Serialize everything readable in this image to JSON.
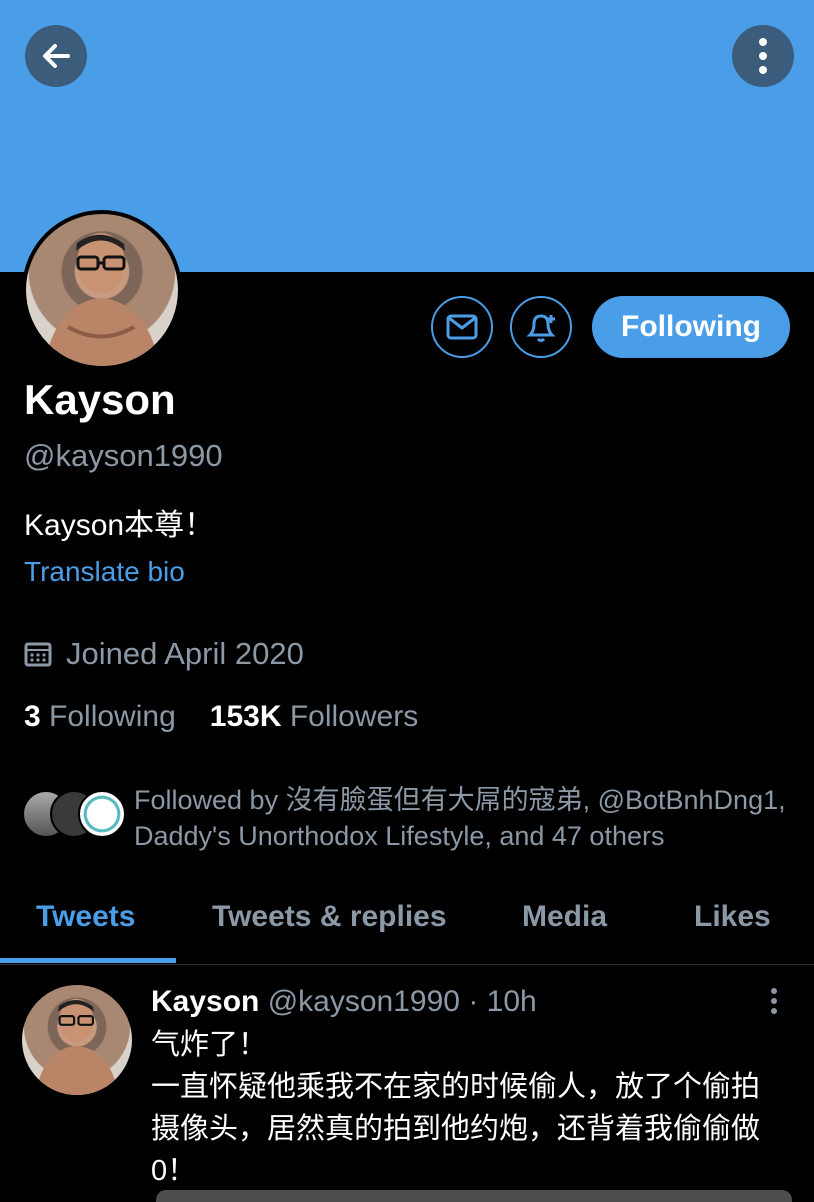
{
  "header": {
    "back_icon": "back-arrow-icon",
    "more_icon": "more-vertical-icon",
    "banner_color": "#4a9ee8"
  },
  "actions": {
    "message_icon": "envelope-icon",
    "notify_icon": "bell-plus-icon",
    "follow_label": "Following"
  },
  "profile": {
    "name": "Kayson",
    "handle": "@kayson1990",
    "bio": "Kayson本尊！",
    "translate_label": "Translate bio",
    "joined": "Joined April 2020",
    "following_count": "3",
    "following_label": "Following",
    "followers_count": "153K",
    "followers_label": "Followers",
    "followed_by_line1": "Followed by 沒有臉蛋但有大屌的寇弟, @BotBnhDng1,",
    "followed_by_line2": "Daddy's Unorthodox Lifestyle, and 47 others"
  },
  "tabs": [
    {
      "label": "Tweets",
      "active": true
    },
    {
      "label": "Tweets & replies",
      "active": false
    },
    {
      "label": "Media",
      "active": false
    },
    {
      "label": "Likes",
      "active": false
    }
  ],
  "tweet": {
    "name": "Kayson",
    "handle": "@kayson1990",
    "time": "· 10h",
    "line1": "气炸了！",
    "line2": "一直怀疑他乘我不在家的时候偷人，放了个偷拍",
    "line3": "摄像头，居然真的拍到他约炮，还背着我偷偷做",
    "line4": "0！"
  },
  "colors": {
    "accent": "#4a9ee8",
    "background": "#000000",
    "secondary_text": "#8b98a5"
  }
}
